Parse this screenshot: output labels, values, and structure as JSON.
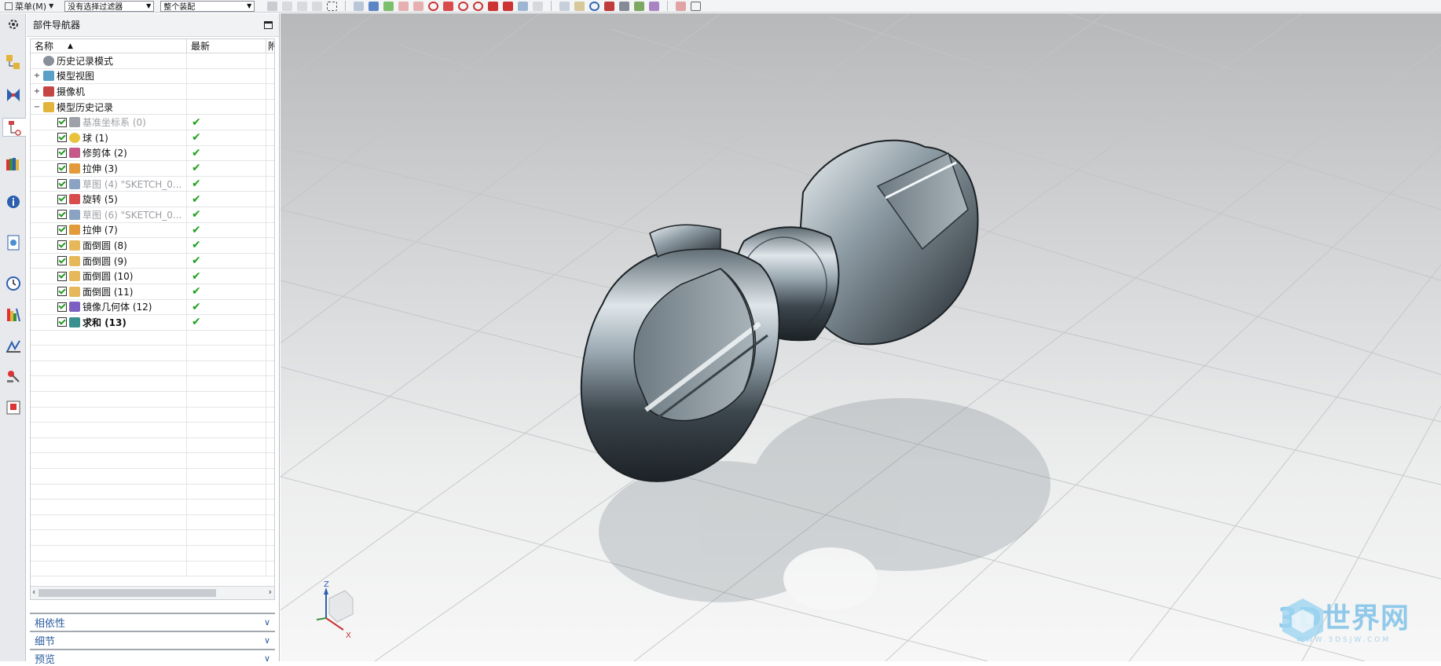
{
  "toolbar": {
    "menu_label": "菜单(M)",
    "filter_select": "没有选择过滤器",
    "scope_select": "整个装配"
  },
  "navigator": {
    "title": "部件导航器",
    "columns": [
      "名称",
      "最新",
      "附"
    ],
    "rows": [
      {
        "label": "历史记录模式",
        "indent": 0,
        "expander": "",
        "checkbox": false,
        "icon": "clock-icon",
        "latest": "",
        "style": "normal"
      },
      {
        "label": "模型视图",
        "indent": 0,
        "expander": "+",
        "checkbox": false,
        "icon": "model-views-icon",
        "latest": "",
        "style": "normal"
      },
      {
        "label": "摄像机",
        "indent": 0,
        "expander": "+",
        "checkbox": false,
        "icon": "camera-icon",
        "latest": "",
        "style": "normal"
      },
      {
        "label": "模型历史记录",
        "indent": 0,
        "expander": "−",
        "checkbox": false,
        "icon": "folder-open-icon",
        "latest": "",
        "style": "normal"
      },
      {
        "label": "基准坐标系 (0)",
        "indent": 1,
        "expander": "",
        "checkbox": true,
        "icon": "datum-csys-icon",
        "latest": "✔",
        "style": "grey"
      },
      {
        "label": "球 (1)",
        "indent": 1,
        "expander": "",
        "checkbox": true,
        "icon": "sphere-icon",
        "latest": "✔",
        "style": "normal"
      },
      {
        "label": "修剪体 (2)",
        "indent": 1,
        "expander": "",
        "checkbox": true,
        "icon": "trim-body-icon",
        "latest": "✔",
        "style": "normal"
      },
      {
        "label": "拉伸 (3)",
        "indent": 1,
        "expander": "",
        "checkbox": true,
        "icon": "extrude-icon",
        "latest": "✔",
        "style": "normal"
      },
      {
        "label": "草图 (4) \"SKETCH_0...",
        "indent": 1,
        "expander": "",
        "checkbox": true,
        "icon": "sketch-icon",
        "latest": "✔",
        "style": "grey"
      },
      {
        "label": "旋转 (5)",
        "indent": 1,
        "expander": "",
        "checkbox": true,
        "icon": "revolve-icon",
        "latest": "✔",
        "style": "normal"
      },
      {
        "label": "草图 (6) \"SKETCH_0...",
        "indent": 1,
        "expander": "",
        "checkbox": true,
        "icon": "sketch-icon",
        "latest": "✔",
        "style": "grey"
      },
      {
        "label": "拉伸 (7)",
        "indent": 1,
        "expander": "",
        "checkbox": true,
        "icon": "extrude-icon",
        "latest": "✔",
        "style": "normal"
      },
      {
        "label": "面倒圆 (8)",
        "indent": 1,
        "expander": "",
        "checkbox": true,
        "icon": "face-blend-icon",
        "latest": "✔",
        "style": "normal"
      },
      {
        "label": "面倒圆 (9)",
        "indent": 1,
        "expander": "",
        "checkbox": true,
        "icon": "face-blend-icon",
        "latest": "✔",
        "style": "normal"
      },
      {
        "label": "面倒圆 (10)",
        "indent": 1,
        "expander": "",
        "checkbox": true,
        "icon": "face-blend-icon",
        "latest": "✔",
        "style": "normal"
      },
      {
        "label": "面倒圆 (11)",
        "indent": 1,
        "expander": "",
        "checkbox": true,
        "icon": "face-blend-icon",
        "latest": "✔",
        "style": "normal"
      },
      {
        "label": "镜像几何体 (12)",
        "indent": 1,
        "expander": "",
        "checkbox": true,
        "icon": "mirror-geometry-icon",
        "latest": "✔",
        "style": "normal"
      },
      {
        "label": "求和 (13)",
        "indent": 1,
        "expander": "",
        "checkbox": true,
        "icon": "unite-icon",
        "latest": "✔",
        "style": "bold"
      }
    ],
    "empty_rows": 16,
    "sections": [
      "相依性",
      "细节",
      "预览"
    ]
  },
  "viewport": {
    "triad_labels": {
      "z": "Z",
      "x": "X"
    }
  },
  "watermark": {
    "text": "3D世界网",
    "subtext": "WWW.3DSJW.COM"
  }
}
